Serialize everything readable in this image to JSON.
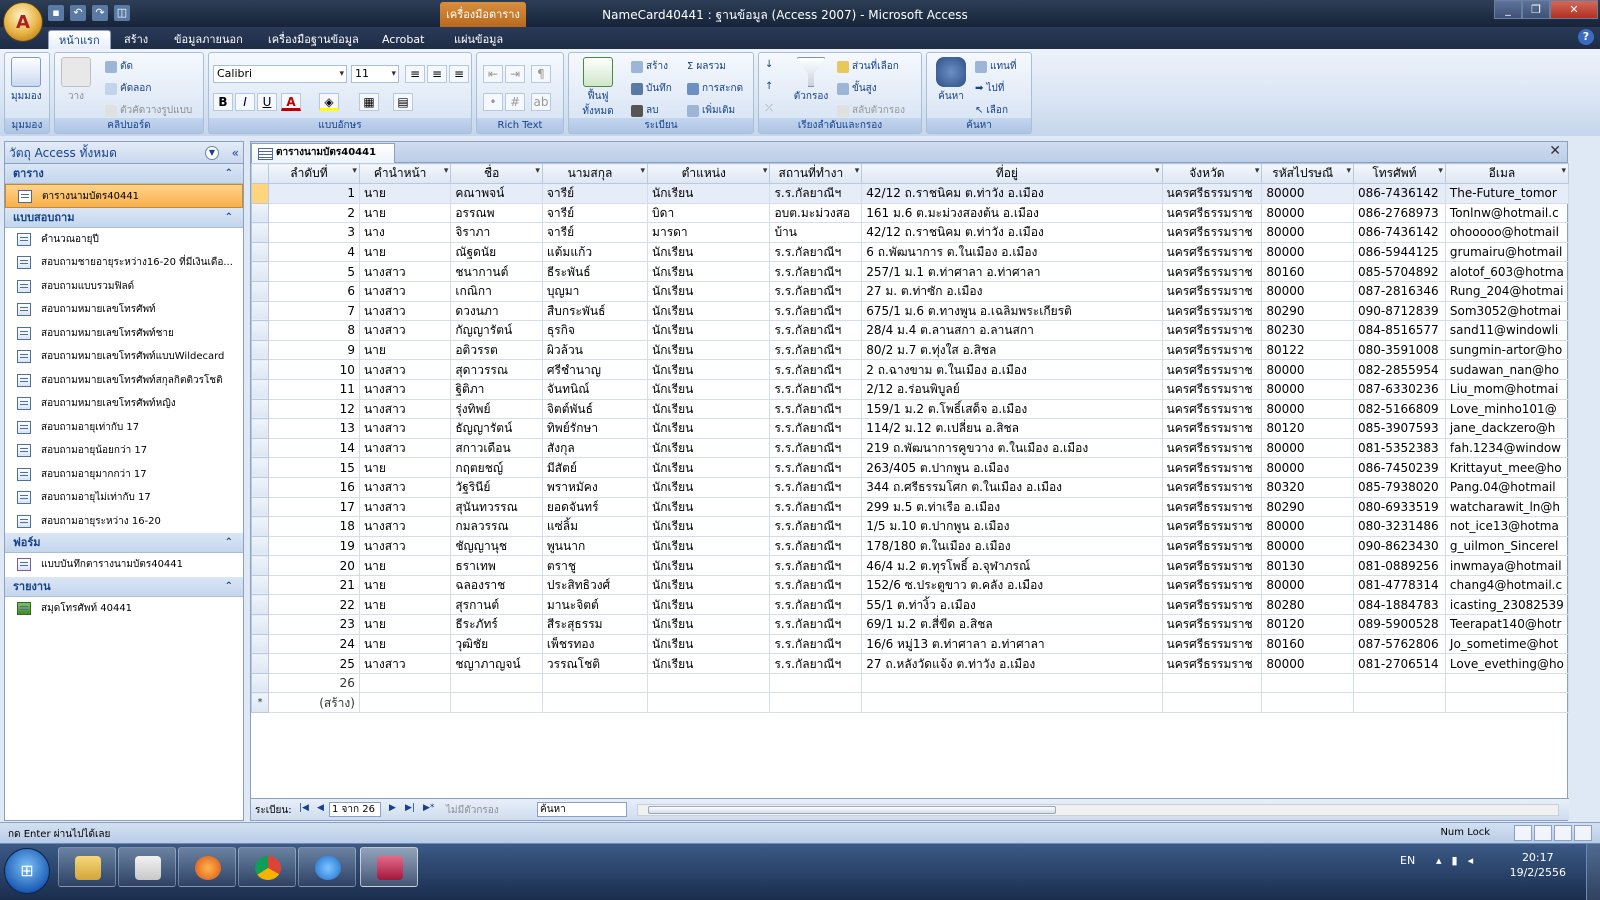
{
  "window": {
    "title": "NameCard40441 : ฐานข้อมูล (Access 2007) - Microsoft Access",
    "context_tab": "เครื่องมือตาราง",
    "controls": [
      "_",
      "❐",
      "✕"
    ]
  },
  "ribbon_tabs": [
    "หน้าแรก",
    "สร้าง",
    "ข้อมูลภายนอก",
    "เครื่องมือฐานข้อมูล",
    "Acrobat",
    "แผ่นข้อมูล"
  ],
  "help_icon": "?",
  "ribbon": {
    "groups": {
      "views": "มุมมอง",
      "clipboard": "คลิปบอร์ด",
      "font": "แบบอักษร",
      "richtext": "Rich Text",
      "records": "ระเบียน",
      "sortfilter": "เรียงลำดับและกรอง",
      "find": "ค้นหา"
    },
    "view_btn": "มุมมอง",
    "paste_btn": "วาง",
    "cut": "ตัด",
    "copy": "คัดลอก",
    "format_painter": "ตัวคัดวางรูปแบบ",
    "font_name": "Calibri",
    "font_size": "11",
    "bold": "B",
    "italic": "I",
    "underline": "U",
    "refresh_btn": "ฟื้นฟูทั้งหมด",
    "new": "สร้าง",
    "save": "บันทึก",
    "delete": "ลบ",
    "totals": "ผลรวม",
    "spelling": "การสะกด",
    "more": "เพิ่มเติม",
    "filter_btn": "ตัวกรอง",
    "selection": "ส่วนที่เลือก",
    "advanced": "ขั้นสูง",
    "toggle_filter": "สลับตัวกรอง",
    "find_btn": "ค้นหา",
    "replace": "แทนที่",
    "goto": "ไปที่",
    "select": "เลือก"
  },
  "nav": {
    "header": "วัตถุ Access ทั้งหมด",
    "sections": [
      {
        "title": "ตาราง",
        "items": [
          "ตารางนามบัตร40441"
        ]
      },
      {
        "title": "แบบสอบถาม",
        "items": [
          "คำนวณอายุปี",
          "สอบถามชายอายุระหว่าง16-20 ที่มีเงินเดือ...",
          "สอบถามแบบรวมฟิลด์",
          "สอบถามหมายเลขโทรศัพท์",
          "สอบถามหมายเลขโทรศัพท์ชาย",
          "สอบถามหมายเลขโทรศัพท์แบบWildecard",
          "สอบถามหมายเลขโทรศัพท์สกุลกิตติวรโชติ",
          "สอบถามหมายเลขโทรศัพท์หญิง",
          "สอบถามอายุเท่ากับ 17",
          "สอบถามอายุน้อยกว่า 17",
          "สอบถามอายุมากกว่า 17",
          "สอบถามอายุไม่เท่ากับ 17",
          "สอบถามอายุระหว่าง 16-20"
        ]
      },
      {
        "title": "ฟอร์ม",
        "items": [
          "แบบบันทึกตารางนามบัตร40441"
        ]
      },
      {
        "title": "รายงาน",
        "items": [
          "สมุดโทรศัพท์ 40441"
        ]
      }
    ]
  },
  "doc_tab": "ตารางนามบัตร40441",
  "doc_close": "✕",
  "grid": {
    "columns": [
      "ลำดับที่",
      "คำนำหน้า",
      "ชื่อ",
      "นามสกุล",
      "ตำแหน่ง",
      "สถานที่ทำงา",
      "ที่อยู่",
      "จังหวัด",
      "รหัสไปรษณี",
      "โทรศัพท์",
      "อีเมล"
    ],
    "rows": [
      [
        "1",
        "นาย",
        "คณาพจน์",
        "จารีย์",
        "นักเรียน",
        "ร.ร.กัลยาณีฯ",
        "42/12 ถ.ราชนิคม  ต.ท่าวัง  อ.เมือง",
        "นครศรีธรรมราช",
        "80000",
        "086-7436142",
        "The-Future_tomor"
      ],
      [
        "2",
        "นาย",
        "อรรณพ",
        "จารีย์",
        "บิดา",
        "อบต.มะม่วงสอ",
        "161 ม.6 ต.มะม่วงสองต้น  อ.เมือง",
        "นครศรีธรรมราช",
        "80000",
        "086-2768973",
        "Tonlnw@hotmail.c"
      ],
      [
        "3",
        "นาง",
        "จิราภา",
        "จารีย์",
        "มารดา",
        "บ้าน",
        "42/12 ถ.ราชนิคม  ต.ท่าวัง  อ.เมือง",
        "นครศรีธรรมราช",
        "80000",
        "086-7436142",
        "ohooooo@hotmail"
      ],
      [
        "4",
        "นาย",
        "ณัฐดนัย",
        "แต้มแก้ว",
        "นักเรียน",
        "ร.ร.กัลยาณีฯ",
        "6 ถ.พัฒนาการ  ต.ในเมือง  อ.เมือง",
        "นครศรีธรรมราช",
        "80000",
        "086-5944125",
        "grumairu@hotmail"
      ],
      [
        "5",
        "นางสาว",
        "ชนากานต์",
        "ธีระพันธ์",
        "นักเรียน",
        "ร.ร.กัลยาณีฯ",
        "257/1 ม.1 ต.ท่าศาลา  อ.ท่าศาลา",
        "นครศรีธรรมราช",
        "80160",
        "085-5704892",
        "alotof_603@hotma"
      ],
      [
        "6",
        "นางสาว",
        "เกณิกา",
        "บุญมา",
        "นักเรียน",
        "ร.ร.กัลยาณีฯ",
        "27 ม. ต.ท่าซัก  อ.เมือง",
        "นครศรีธรรมราช",
        "80000",
        "087-2816346",
        "Rung_204@hotmai"
      ],
      [
        "7",
        "นางสาว",
        "ดวงนภา",
        "สืบกระพันธ์",
        "นักเรียน",
        "ร.ร.กัลยาณีฯ",
        "675/1 ม.6 ต.ทางพูน  อ.เฉลิมพระเกียรติ",
        "นครศรีธรรมราช",
        "80290",
        "090-8712839",
        "Som3052@hotmai"
      ],
      [
        "8",
        "นางสาว",
        "กัญญารัตน์",
        "ธุรกิจ",
        "นักเรียน",
        "ร.ร.กัลยาณีฯ",
        "28/4 ม.4 ต.ลานสกา  อ.ลานสกา",
        "นครศรีธรรมราช",
        "80230",
        "084-8516577",
        "sand11@windowli"
      ],
      [
        "9",
        "นาย",
        "อติวรรต",
        "ผิวล้วน",
        "นักเรียน",
        "ร.ร.กัลยาณีฯ",
        "80/2 ม.7 ต.ทุ่งใส  อ.สิชล",
        "นครศรีธรรมราช",
        "80122",
        "080-3591008",
        "sungmin-artor@ho"
      ],
      [
        "10",
        "นางสาว",
        "สุดาวรรณ",
        "ศรีชำนาญ",
        "นักเรียน",
        "ร.ร.กัลยาณีฯ",
        "2 ถ.ฉางขาม  ต.ในเมือง  อ.เมือง",
        "นครศรีธรรมราช",
        "80000",
        "082-2855954",
        "sudawan_nan@ho"
      ],
      [
        "11",
        "นางสาว",
        "ฐิติภา",
        "จันทนิณ์",
        "นักเรียน",
        "ร.ร.กัลยาณีฯ",
        "2/12 อ.ร่อนพิบูลย์",
        "นครศรีธรรมราช",
        "80000",
        "087-6330236",
        "Liu_mom@hotmai"
      ],
      [
        "12",
        "นางสาว",
        "รุ่งทิพย์",
        "จิตต์พันธ์",
        "นักเรียน",
        "ร.ร.กัลยาณีฯ",
        "159/1 ม.2 ต.โพธิ์เสด็จ  อ.เมือง",
        "นครศรีธรรมราช",
        "80000",
        "082-5166809",
        "Love_minho101@"
      ],
      [
        "13",
        "นางสาว",
        "ธัญญารัตน์",
        "ทิพย์รักษา",
        "นักเรียน",
        "ร.ร.กัลยาณีฯ",
        "114/2 ม.12 ต.เปลี่ยน  อ.สิชล",
        "นครศรีธรรมราช",
        "80120",
        "085-3907593",
        "jane_dackzero@h"
      ],
      [
        "14",
        "นางสาว",
        "สกาวเดือน",
        "สังกุล",
        "นักเรียน",
        "ร.ร.กัลยาณีฯ",
        "219 ถ.พัฒนาการคูขวาง  ต.ในเมือง  อ.เมือง",
        "นครศรีธรรมราช",
        "80000",
        "081-5352383",
        "fah.1234@window"
      ],
      [
        "15",
        "นาย",
        "กฤตยชญ์",
        "มีสัตย์",
        "นักเรียน",
        "ร.ร.กัลยาณีฯ",
        "263/405 ต.ปากพูน  อ.เมือง",
        "นครศรีธรรมราช",
        "80000",
        "086-7450239",
        "Krittayut_mee@ho"
      ],
      [
        "16",
        "นางสาว",
        "วัฐรินีย์",
        "พราหมัคง",
        "นักเรียน",
        "ร.ร.กัลยาณีฯ",
        "344 ถ.ศรีธรรมโศก  ต.ในเมือง  อ.เมือง",
        "นครศรีธรรมราช",
        "80320",
        "085-7938020",
        "Pang.04@hotmail"
      ],
      [
        "17",
        "นางสาว",
        "สุนันทวรรณ",
        "ยอดจันทร์",
        "นักเรียน",
        "ร.ร.กัลยาณีฯ",
        "299 ม.5 ต.ท่าเรือ  อ.เมือง",
        "นครศรีธรรมราช",
        "80290",
        "080-6933519",
        "watcharawit_ln@h"
      ],
      [
        "18",
        "นางสาว",
        "กมลวรรณ",
        "แซ่ลิ้ม",
        "นักเรียน",
        "ร.ร.กัลยาณีฯ",
        "1/5 ม.10 ต.ปากพูน  อ.เมือง",
        "นครศรีธรรมราช",
        "80000",
        "080-3231486",
        "not_ice13@hotma"
      ],
      [
        "19",
        "นางสาว",
        "ชัญญานุช",
        "พูนนาก",
        "นักเรียน",
        "ร.ร.กัลยาณีฯ",
        "178/180 ต.ในเมือง  อ.เมือง",
        "นครศรีธรรมราช",
        "80000",
        "090-8623430",
        "g_uilmon_Sincerel"
      ],
      [
        "20",
        "นาย",
        "ธราเทพ",
        "ตราชู",
        "นักเรียน",
        "ร.ร.กัลยาณีฯ",
        "46/4 ม.2 ต.ทุรโพธิ์  อ.จุฬาภรณ์",
        "นครศรีธรรมราช",
        "80130",
        "081-0889256",
        "inwmaya@hotmail"
      ],
      [
        "21",
        "นาย",
        "ฉลองราช",
        "ประสิทธิวงศ์",
        "นักเรียน",
        "ร.ร.กัลยาณีฯ",
        "152/6 ซ.ประตูขาว  ต.คลัง  อ.เมือง",
        "นครศรีธรรมราช",
        "80000",
        "081-4778314",
        "chang4@hotmail.c"
      ],
      [
        "22",
        "นาย",
        "สุรกานต์",
        "มานะจิตต์",
        "นักเรียน",
        "ร.ร.กัลยาณีฯ",
        "55/1 ต.ท่างิ้ว  อ.เมือง",
        "นครศรีธรรมราช",
        "80280",
        "084-1884783",
        "icasting_23082539"
      ],
      [
        "23",
        "นาย",
        "ธีระภัทร์",
        "สีระสุธรรม",
        "นักเรียน",
        "ร.ร.กัลยาณีฯ",
        "69/1 ม.2 ต.สี่ขีด  อ.สิชล",
        "นครศรีธรรมราช",
        "80120",
        "089-5900528",
        "Teerapat140@hotr"
      ],
      [
        "24",
        "นาย",
        "วุฒิชัย",
        "เพ็ชรทอง",
        "นักเรียน",
        "ร.ร.กัลยาณีฯ",
        "16/6 หมู่13 ต.ท่าศาลา  อ.ท่าศาลา",
        "นครศรีธรรมราช",
        "80160",
        "087-5762806",
        "Jo_sometime@hot"
      ],
      [
        "25",
        "นางสาว",
        "ชญาภาญจน์",
        "วรรณโชติ",
        "นักเรียน",
        "ร.ร.กัลยาณีฯ",
        "27 ถ.หลังวัดแจ้ง  ต.ท่าวัง  อ.เมือง",
        "นครศรีธรรมราช",
        "80000",
        "081-2706514",
        "Love_evething@ho"
      ]
    ],
    "pending_row_id": "26",
    "new_row_label": "(สร้าง)",
    "new_row_marker": "*"
  },
  "record_nav": {
    "label": "ระเบียน:",
    "position": "1 จาก 26",
    "no_filter": "ไม่มีตัวกรอง",
    "search": "ค้นหา"
  },
  "status": {
    "text": "กด Enter ผ่านไปได้เลย",
    "numlock": "Num Lock"
  },
  "taskbar": {
    "lang": "EN",
    "time": "20:17",
    "date": "19/2/2556"
  },
  "colors": {
    "ribbon_text": "#15428b",
    "selection": "#f9b04a",
    "context_tab": "#d88f3e"
  }
}
